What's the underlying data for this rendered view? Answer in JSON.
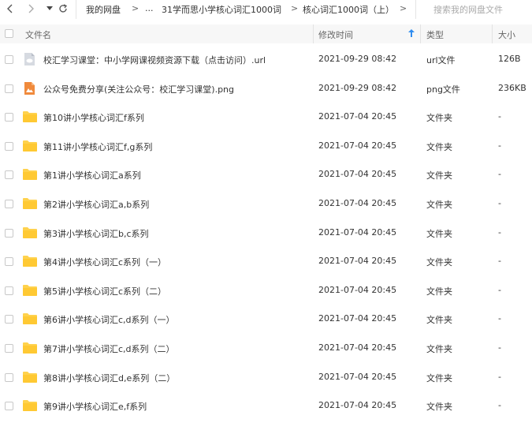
{
  "toolbar": {
    "breadcrumb": [
      "我的网盘",
      "...",
      "31学而思小学核心词汇1000词",
      "核心词汇1000词（上）"
    ],
    "search_placeholder": "搜索我的网盘文件"
  },
  "columns": {
    "name": "文件名",
    "modified": "修改时间",
    "type": "类型",
    "size": "大小"
  },
  "files": [
    {
      "name": "校汇学习课堂：中小学网课视频资源下载（点击访问）.url",
      "modified": "2021-09-29 08:42",
      "type": "url文件",
      "size": "126B",
      "icon": "url-file-icon"
    },
    {
      "name": "公众号免费分享(关注公众号：校汇学习课堂).png",
      "modified": "2021-09-29 08:42",
      "type": "png文件",
      "size": "236KB",
      "icon": "image-file-icon"
    },
    {
      "name": "第10讲小学核心词汇f系列",
      "modified": "2021-07-04 20:45",
      "type": "文件夹",
      "size": "-",
      "icon": "folder-icon"
    },
    {
      "name": "第11讲小学核心词汇f,g系列",
      "modified": "2021-07-04 20:45",
      "type": "文件夹",
      "size": "-",
      "icon": "folder-icon"
    },
    {
      "name": "第1讲小学核心词汇a系列",
      "modified": "2021-07-04 20:45",
      "type": "文件夹",
      "size": "-",
      "icon": "folder-icon"
    },
    {
      "name": "第2讲小学核心词汇a,b系列",
      "modified": "2021-07-04 20:45",
      "type": "文件夹",
      "size": "-",
      "icon": "folder-icon"
    },
    {
      "name": "第3讲小学核心词汇b,c系列",
      "modified": "2021-07-04 20:45",
      "type": "文件夹",
      "size": "-",
      "icon": "folder-icon"
    },
    {
      "name": "第4讲小学核心词汇c系列（一）",
      "modified": "2021-07-04 20:45",
      "type": "文件夹",
      "size": "-",
      "icon": "folder-icon"
    },
    {
      "name": "第5讲小学核心词汇c系列（二）",
      "modified": "2021-07-04 20:45",
      "type": "文件夹",
      "size": "-",
      "icon": "folder-icon"
    },
    {
      "name": "第6讲小学核心词汇c,d系列（一）",
      "modified": "2021-07-04 20:45",
      "type": "文件夹",
      "size": "-",
      "icon": "folder-icon"
    },
    {
      "name": "第7讲小学核心词汇c,d系列（二）",
      "modified": "2021-07-04 20:45",
      "type": "文件夹",
      "size": "-",
      "icon": "folder-icon"
    },
    {
      "name": "第8讲小学核心词汇d,e系列（二）",
      "modified": "2021-07-04 20:45",
      "type": "文件夹",
      "size": "-",
      "icon": "folder-icon"
    },
    {
      "name": "第9讲小学核心词汇e,f系列",
      "modified": "2021-07-04 20:45",
      "type": "文件夹",
      "size": "-",
      "icon": "folder-icon"
    }
  ],
  "colors": {
    "folder": "#ffd24d",
    "image_icon": "#f08a3c",
    "url_icon": "#c9ced6",
    "sort_arrow": "#2f8cf0"
  }
}
